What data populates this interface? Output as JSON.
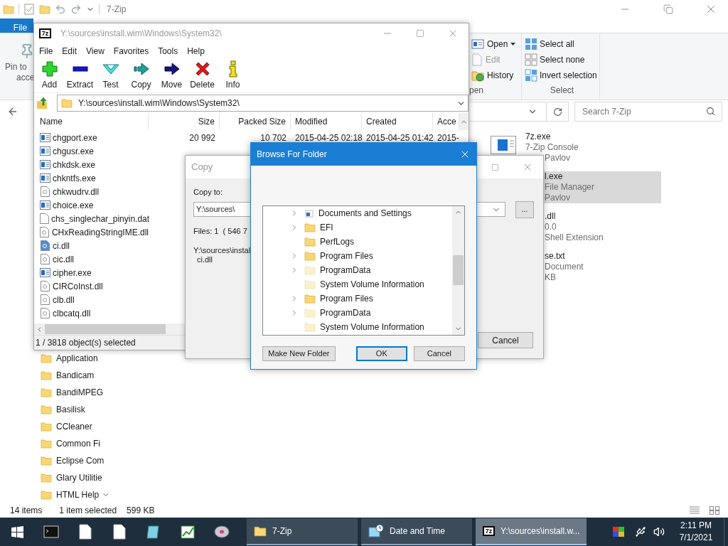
{
  "explorer": {
    "title": "7-Zip",
    "file_tab": "File",
    "pin_lines": [
      "Pin to",
      "acce"
    ],
    "open_group": {
      "label": "pen",
      "items": [
        {
          "label": "Open",
          "kind": "open",
          "dropdown": true,
          "disabled": false
        },
        {
          "label": "Edit",
          "kind": "edit",
          "dropdown": false,
          "disabled": true
        },
        {
          "label": "History",
          "kind": "history",
          "dropdown": false,
          "disabled": false
        }
      ]
    },
    "select_group": {
      "label": "Select",
      "items": [
        {
          "label": "Select all",
          "kind": "all"
        },
        {
          "label": "Select none",
          "kind": "none"
        },
        {
          "label": "Invert selection",
          "kind": "invert"
        }
      ]
    },
    "search": {
      "placeholder": "Search 7-Zip"
    },
    "items": [
      {
        "icon_visible": true,
        "selected": false,
        "lines": [
          {
            "text": "7z.exe",
            "partly_hidden": false
          },
          {
            "text": "7-Zip Console",
            "partly_hidden": false
          },
          {
            "text": "Pavlov",
            "partly_hidden": true
          }
        ]
      },
      {
        "icon_visible": false,
        "selected": true,
        "lines": [
          {
            "text": "l.exe",
            "partly_hidden": true
          },
          {
            "text": "File Manager",
            "partly_hidden": true
          },
          {
            "text": "Pavlov",
            "partly_hidden": true
          }
        ]
      },
      {
        "icon_visible": false,
        "selected": false,
        "lines": [
          {
            "text": ".dll",
            "partly_hidden": true
          },
          {
            "text": "0.0",
            "partly_hidden": true
          },
          {
            "text": "Shell Extension",
            "partly_hidden": true
          }
        ]
      },
      {
        "icon_visible": false,
        "selected": false,
        "lines": [
          {
            "text": "se.txt",
            "partly_hidden": true
          },
          {
            "text": "Document",
            "partly_hidden": true
          },
          {
            "text": "KB",
            "partly_hidden": true
          }
        ]
      }
    ],
    "nav_items": [
      "Application",
      "Bandicam",
      "BandiMPEG",
      "Basilisk",
      "CCleaner",
      "Common Fi",
      "Eclipse Com",
      "Glary Utilitie",
      "HTML Help"
    ],
    "status": {
      "count": "14 items",
      "selection": "1 item selected",
      "size": "599 KB"
    }
  },
  "seven_zip": {
    "logo": "7z",
    "title": "Y:\\sources\\install.wim\\Windows\\System32\\",
    "menu": [
      "File",
      "Edit",
      "View",
      "Favorites",
      "Tools",
      "Help"
    ],
    "toolbar": [
      {
        "kind": "add",
        "label": "Add"
      },
      {
        "kind": "extract",
        "label": "Extract"
      },
      {
        "kind": "test",
        "label": "Test"
      },
      {
        "kind": "copy",
        "label": "Copy"
      },
      {
        "kind": "move",
        "label": "Move"
      },
      {
        "kind": "delete",
        "label": "Delete"
      },
      {
        "kind": "info",
        "label": "Info"
      }
    ],
    "path": "Y:\\sources\\install.wim\\Windows\\System32\\",
    "columns": [
      "Name",
      "Size",
      "Packed Size",
      "Modified",
      "Created",
      "Acce"
    ],
    "rows": [
      {
        "kind": "exe",
        "selected": false,
        "cells": [
          "chgport.exe",
          "20 992",
          "10 702",
          "2015-04-25 02:18",
          "2015-04-25 01:42",
          "2015-"
        ]
      },
      {
        "kind": "exe",
        "selected": false,
        "cells": [
          "chgusr.exe"
        ]
      },
      {
        "kind": "exe",
        "selected": false,
        "cells": [
          "chkdsk.exe"
        ]
      },
      {
        "kind": "exe",
        "selected": false,
        "cells": [
          "chkntfs.exe"
        ]
      },
      {
        "kind": "dll",
        "selected": false,
        "cells": [
          "chkwudrv.dll"
        ]
      },
      {
        "kind": "exe",
        "selected": false,
        "cells": [
          "choice.exe"
        ]
      },
      {
        "kind": "file",
        "selected": false,
        "cells": [
          "chs_singlechar_pinyin.dat"
        ]
      },
      {
        "kind": "dll",
        "selected": false,
        "cells": [
          "CHxReadingStringIME.dll"
        ]
      },
      {
        "kind": "dll",
        "selected": true,
        "cells": [
          "ci.dll"
        ]
      },
      {
        "kind": "dll",
        "selected": false,
        "cells": [
          "cic.dll"
        ]
      },
      {
        "kind": "exe",
        "selected": false,
        "cells": [
          "cipher.exe"
        ]
      },
      {
        "kind": "dll",
        "selected": false,
        "cells": [
          "CIRCoInst.dll"
        ]
      },
      {
        "kind": "dll",
        "selected": false,
        "cells": [
          "clb.dll"
        ]
      },
      {
        "kind": "dll",
        "selected": false,
        "cells": [
          "clbcatq.dll"
        ]
      }
    ],
    "status": "1 / 3818 object(s) selected"
  },
  "copy_dialog": {
    "title": "Copy",
    "label": "Copy to:",
    "path": "Y:\\sources\\",
    "browse": "...",
    "files": "Files: 1  ( 546 7",
    "source": "Y:\\sources\\instal",
    "file": "ci.dll",
    "cancel": "Cancel"
  },
  "browse": {
    "title": "Browse For Folder",
    "tree": [
      {
        "label": "Documents and Settings",
        "kind": "link",
        "expandable": true
      },
      {
        "label": "EFI",
        "kind": "folder",
        "expandable": true
      },
      {
        "label": "PerfLogs",
        "kind": "folder",
        "expandable": false
      },
      {
        "label": "Program Files",
        "kind": "folder",
        "expandable": true
      },
      {
        "label": "ProgramData",
        "kind": "hidden",
        "expandable": true
      },
      {
        "label": "System Volume Information",
        "kind": "hidden",
        "expandable": false
      },
      {
        "label": "Program Files",
        "kind": "folder",
        "expandable": true
      },
      {
        "label": "ProgramData",
        "kind": "hidden",
        "expandable": true
      },
      {
        "label": "System Volume Information",
        "kind": "hidden",
        "expandable": false
      }
    ],
    "buttons": [
      {
        "label": "Make New Folder",
        "default": false
      },
      {
        "label": "OK",
        "default": true
      },
      {
        "label": "Cancel",
        "default": false
      }
    ]
  },
  "taskbar": {
    "tasks": [
      {
        "label": "7-Zip",
        "kind": "folder",
        "selected": false
      },
      {
        "label": "Date and Time",
        "kind": "clock",
        "selected": false
      },
      {
        "label": "Y:\\sources\\install.w...",
        "kind": "archiver",
        "logo": "7z",
        "selected": true
      }
    ],
    "time": "2:11 PM",
    "date": "7/1/2021"
  }
}
